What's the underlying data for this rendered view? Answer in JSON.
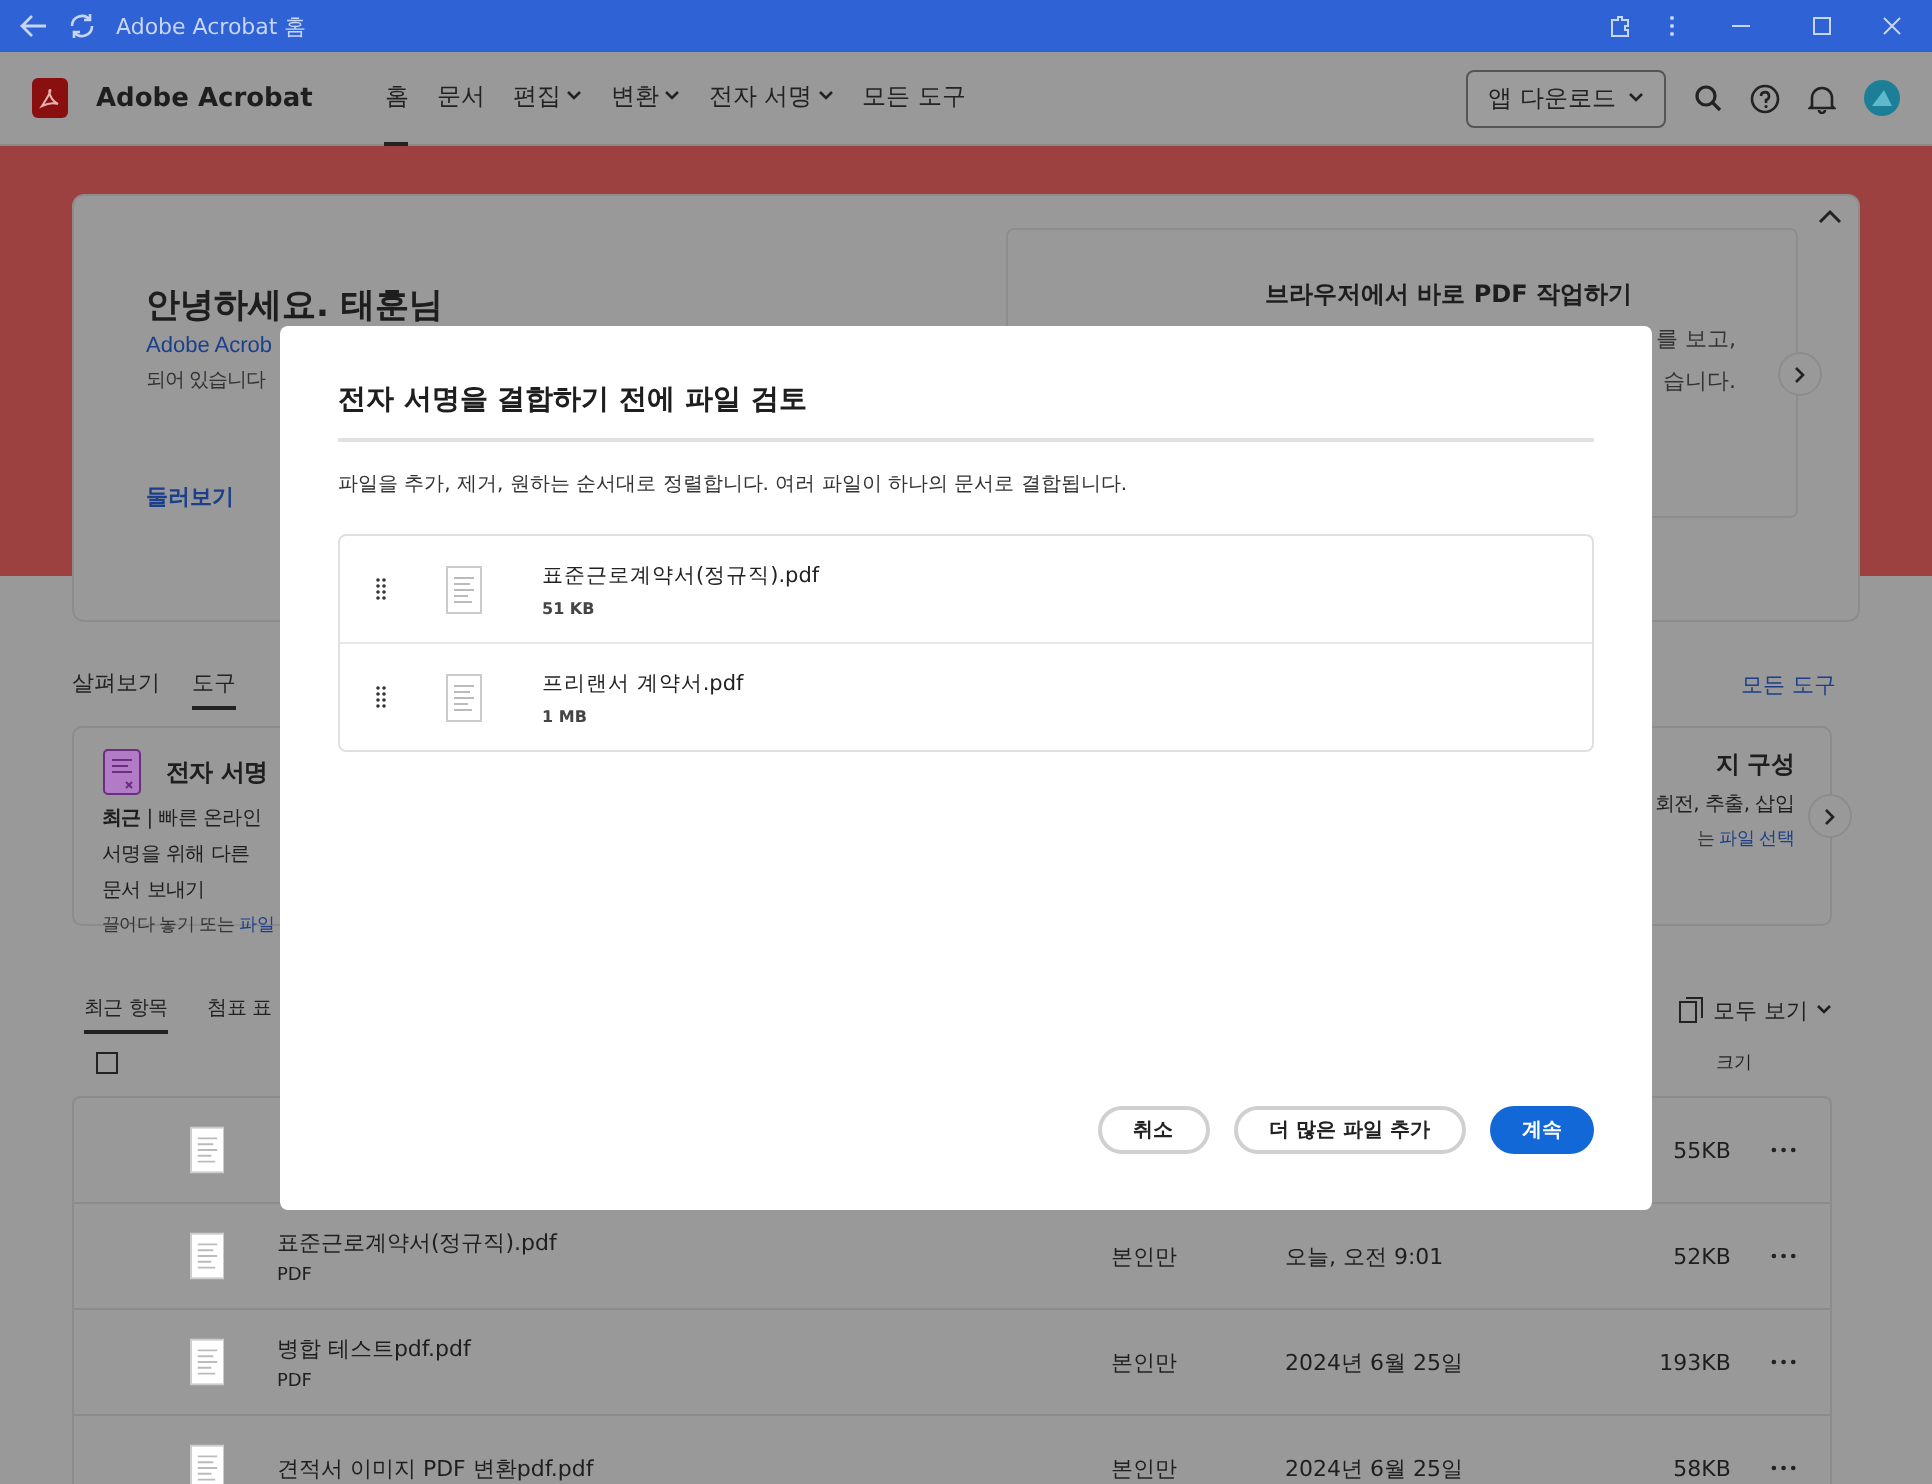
{
  "browser": {
    "title": "Adobe Acrobat 홈"
  },
  "app": {
    "name": "Adobe Acrobat",
    "download_button": "앱 다운로드",
    "nav": [
      {
        "label": "홈",
        "selected": true,
        "dropdown": false
      },
      {
        "label": "문서",
        "selected": false,
        "dropdown": false
      },
      {
        "label": "편집",
        "selected": false,
        "dropdown": true
      },
      {
        "label": "변환",
        "selected": false,
        "dropdown": true
      },
      {
        "label": "전자 서명",
        "selected": false,
        "dropdown": true
      },
      {
        "label": "모든 도구",
        "selected": false,
        "dropdown": false
      }
    ]
  },
  "hero": {
    "greeting": "안녕하세요. 태훈님",
    "line_1": "Adobe Acrob",
    "line_2": "되어 있습니다",
    "link": "둘러보기",
    "promo": {
      "title": "브라우저에서 바로 PDF 작업하기",
      "line_1": "를 보고,",
      "line_2": "습니다."
    }
  },
  "tools_tabs": [
    {
      "label": "살펴보기",
      "selected": false
    },
    {
      "label": "도구",
      "selected": true
    }
  ],
  "all_tools_link": "모든 도구",
  "tool_cards": [
    {
      "title": "전자 서명",
      "lines": [
        "**최근** | 빠른 온라인",
        "서명을 위해 다른",
        "문서 보내기"
      ],
      "hint": "끌어다 놓기 또는",
      "hint_link": "파일"
    },
    {
      "title": "지 구성",
      "lines": [
        "회전, 추출, 삽입"
      ],
      "hint": "는",
      "hint_link": "파일 선택"
    }
  ],
  "recent": {
    "tabs": [
      {
        "label": "최근 항목",
        "selected": true
      },
      {
        "label": "첨표 표",
        "selected": false
      }
    ],
    "view_all": "모두 보기",
    "size_header": "크기",
    "select_all_checked": false,
    "rows": [
      {
        "size": "55KB"
      },
      {
        "name": "표준근로계약서(정규직).pdf",
        "type": "PDF",
        "sharing": "본인만",
        "modified": "오늘, 오전 9:01",
        "size": "52KB"
      },
      {
        "name": "병합 테스트pdf.pdf",
        "type": "PDF",
        "sharing": "본인만",
        "modified": "2024년 6월 25일",
        "size": "193KB"
      },
      {
        "name": "견적서 이미지 PDF 변환pdf.pdf",
        "sharing": "본인만",
        "modified": "2024년 6월 25일",
        "size": "58KB"
      }
    ]
  },
  "dialog": {
    "title": "전자 서명을 결합하기 전에 파일 검토",
    "description": "파일을 추가, 제거, 원하는 순서대로 정렬합니다. 여러 파일이 하나의 문서로 결합됩니다.",
    "files": [
      {
        "name": "표준근로계약서(정규직).pdf",
        "size": "51 KB"
      },
      {
        "name": "프리랜서 계약서.pdf",
        "size": "1 MB"
      }
    ],
    "buttons": [
      {
        "label": "취소",
        "kind": "secondary"
      },
      {
        "label": "더 많은 파일 추가",
        "kind": "secondary"
      },
      {
        "label": "계속",
        "kind": "primary"
      }
    ]
  }
}
